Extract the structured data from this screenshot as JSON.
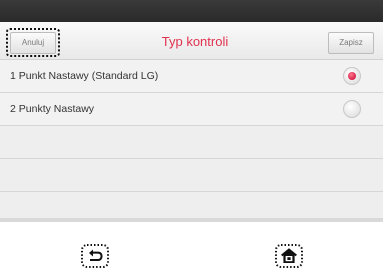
{
  "header": {
    "cancel_label": "Anuluj",
    "title": "Typ kontroli",
    "save_label": "Zapisz"
  },
  "options": [
    {
      "label": "1 Punkt Nastawy (Standard LG)",
      "selected": true
    },
    {
      "label": "2 Punkty Nastawy",
      "selected": false
    }
  ],
  "colors": {
    "title": "#e0314f",
    "radio_selected": "#d61f45"
  },
  "nav": {
    "back_icon": "back-arrow-icon",
    "home_icon": "home-icon"
  }
}
